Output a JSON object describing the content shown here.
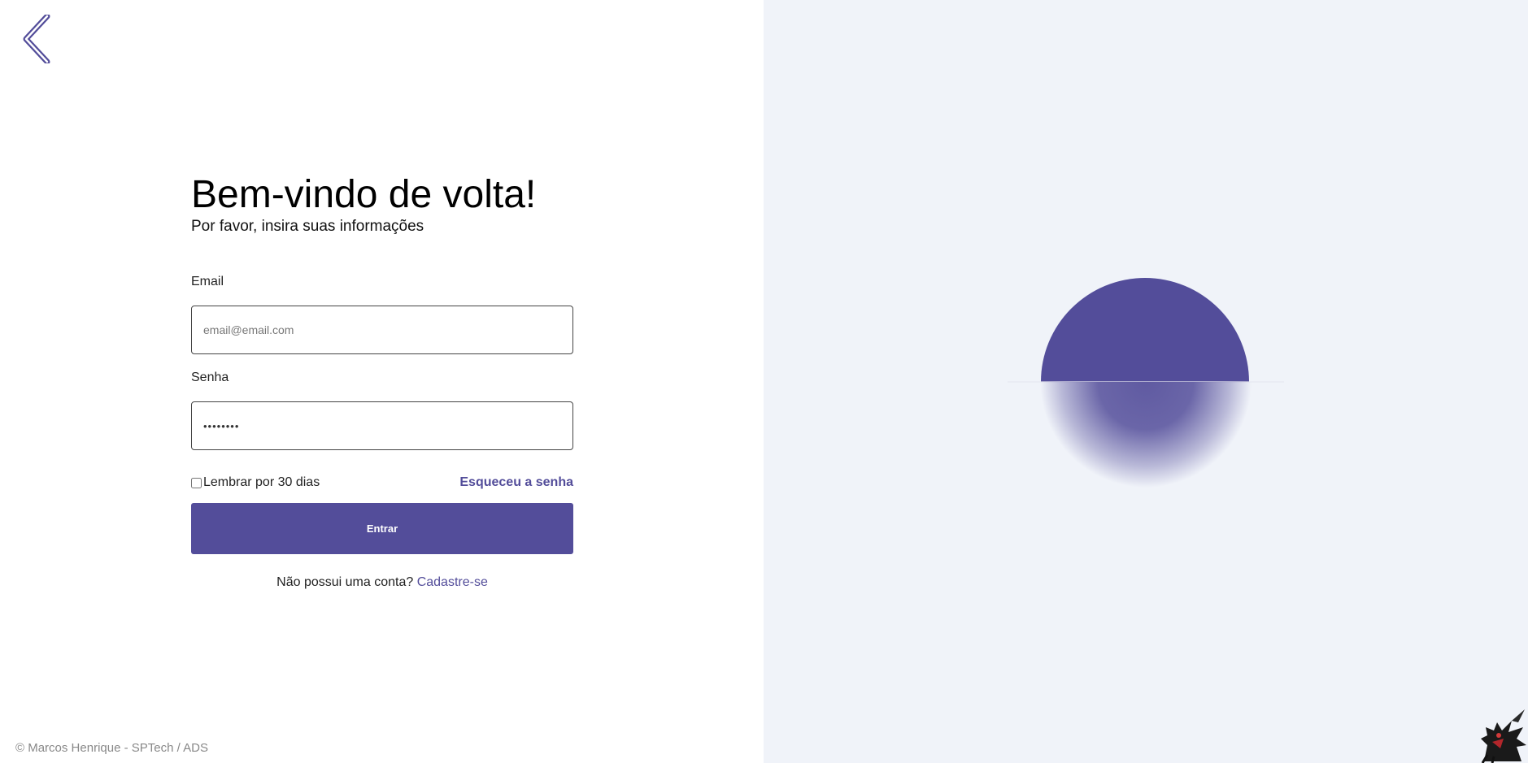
{
  "login": {
    "title": "Bem-vindo de volta!",
    "subtitle": "Por favor, insira suas informações",
    "email_label": "Email",
    "email_placeholder": "email@email.com",
    "password_label": "Senha",
    "password_value": "••••••••",
    "remember_label": "Lembrar por 30 dias",
    "remember_checked": false,
    "forgot_label": "Esqueceu a senha",
    "submit_label": "Entrar",
    "signup_prompt": "Não possui uma conta?",
    "signup_link": "Cadastre-se"
  },
  "footer": {
    "text": "© Marcos Henrique - SPTech / ADS"
  },
  "icons": {
    "back": "chevron-left-icon",
    "mascot": "dragon-mascot-icon"
  },
  "colors": {
    "accent": "#534d9a",
    "right_panel_bg": "#f0f3f9"
  }
}
